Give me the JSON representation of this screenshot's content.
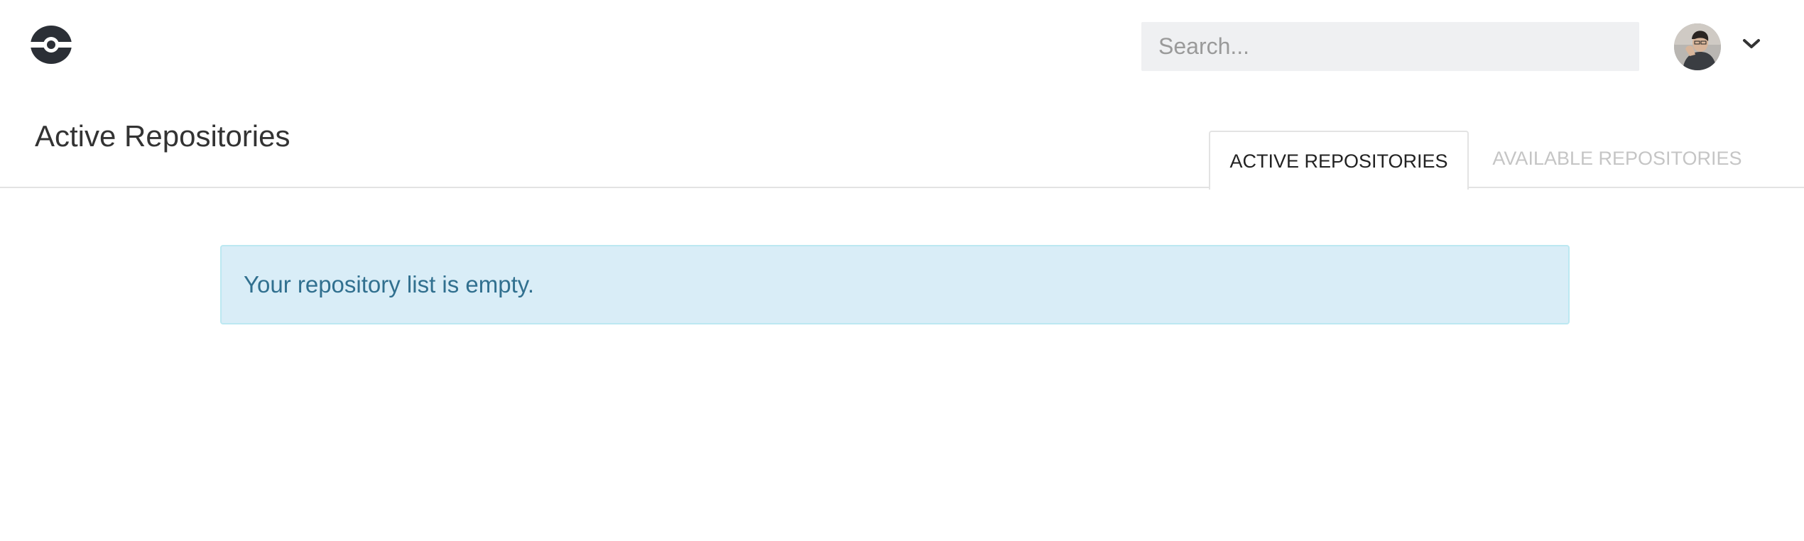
{
  "header": {
    "logo_icon": "drone-logo-icon",
    "search": {
      "placeholder": "Search...",
      "value": ""
    },
    "avatar_icon": "user-avatar",
    "menu_icon": "chevron-down-icon"
  },
  "page": {
    "title": "Active Repositories",
    "tabs": [
      {
        "label": "ACTIVE REPOSITORIES",
        "active": true
      },
      {
        "label": "AVAILABLE REPOSITORIES",
        "active": false
      }
    ]
  },
  "alert": {
    "message": "Your repository list is empty.",
    "colors": {
      "background": "#d9edf7",
      "border": "#bce8f1",
      "text": "#31708f"
    }
  }
}
